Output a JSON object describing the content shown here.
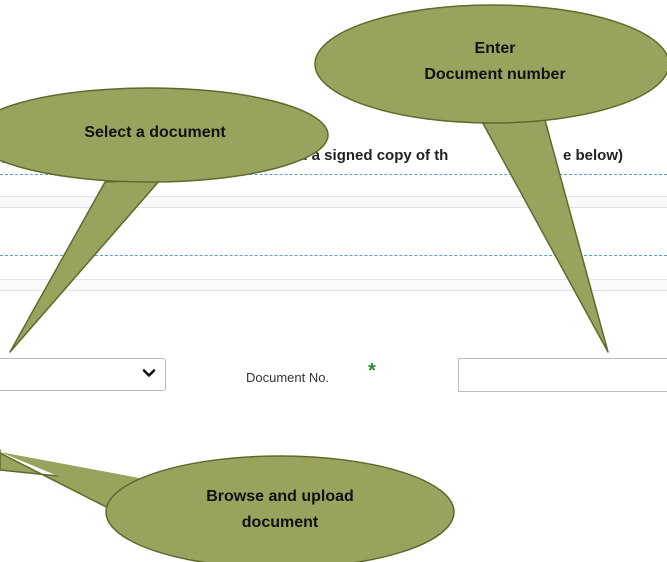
{
  "form": {
    "instruction_parts": [
      "(",
      "ad a signed copy of th",
      "e below)"
    ],
    "document_select_value": "",
    "document_no_label": "Document No.",
    "required_marker": "*",
    "document_no_value": ""
  },
  "callouts": {
    "select_document": "Select a document",
    "enter_number_line1": "Enter",
    "enter_number_line2": "Document number",
    "browse_upload_line1": "Browse and upload",
    "browse_upload_line2": "document"
  },
  "colors": {
    "callout_fill": "#9aa35e",
    "callout_stroke": "#5f6a2c",
    "dashed_line": "#5b9bd5",
    "required_star": "#2e8b2e"
  },
  "icons": {
    "select_chevron": "chevron-down-icon"
  }
}
